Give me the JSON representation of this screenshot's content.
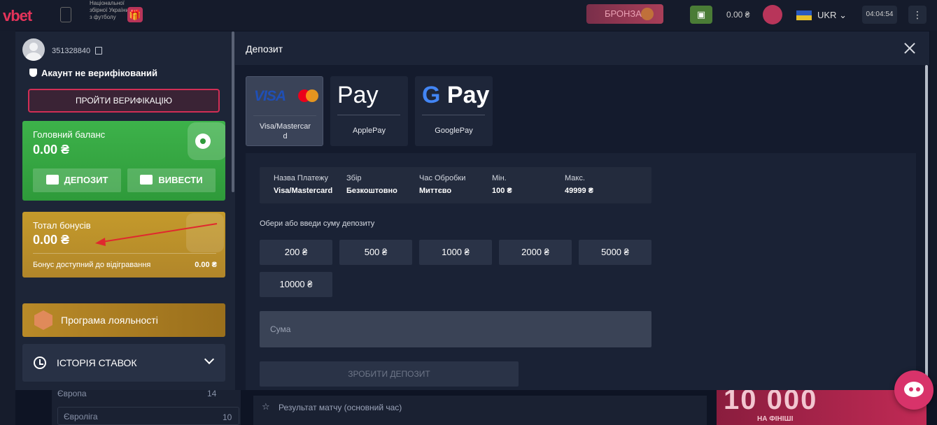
{
  "header": {
    "logo": "vbet",
    "national_text": "Національної збірної України з футболу",
    "level_badge": "БРОНЗА",
    "balance": "0.00 ₴",
    "language": "UKR",
    "time": "04:04:54"
  },
  "account": {
    "user_id": "351328840",
    "verification_status": "Акаунт не верифікований",
    "verify_button": "ПРОЙТИ ВЕРИФІКАЦІЮ",
    "main_balance": {
      "label": "Головний баланс",
      "value": "0.00 ₴",
      "deposit_button": "ДЕПОЗИТ",
      "withdraw_button": "ВИВЕСТИ"
    },
    "bonus": {
      "label": "Тотал бонусів",
      "value": "0.00 ₴",
      "sub_label": "Бонус доступний до відігравання",
      "sub_value": "0.00 ₴"
    },
    "loyalty_label": "Програма лояльності",
    "history_label": "ІСТОРІЯ СТАВОК"
  },
  "deposit": {
    "title": "Депозит",
    "methods": [
      {
        "name": "Visa/Mastercar d",
        "line1": "Visa/Mastercar",
        "line2": "d",
        "icon": "visa-mastercard-icon",
        "active": true
      },
      {
        "name": "ApplePay",
        "icon": "apple-pay-icon",
        "active": false
      },
      {
        "name": "GooglePay",
        "icon": "google-pay-icon",
        "active": false
      }
    ],
    "apple_pay_text": "Pay",
    "google_pay_text": "Pay",
    "visa_text": "VISA",
    "info": {
      "headers": [
        "Назва Платежу",
        "Збір",
        "Час Обробки",
        "Мін.",
        "Макс."
      ],
      "values": [
        "Visa/Mastercard",
        "Безкоштовно",
        "Миттєво",
        "100 ₴",
        "49999 ₴"
      ]
    },
    "choose_label": "Обери або введи суму депозиту",
    "amounts": [
      "200 ₴",
      "500 ₴",
      "1000 ₴",
      "2000 ₴",
      "5000 ₴",
      "10000 ₴"
    ],
    "sum_placeholder": "Сума",
    "submit_button": "ЗРОБИТИ ДЕПОЗИТ"
  },
  "background": {
    "list_row1": "Європа",
    "list_row1_count": "14",
    "list_row2": "Євроліга",
    "list_row2_count": "10",
    "match_label": "Результат матчу (основний час)",
    "promo_big": "10 000",
    "promo_small": "НА ФІНІШІ"
  },
  "colors": {
    "accent_red": "#d12e55",
    "balance_green": "#3db24a",
    "bonus_gold": "#c49a2b",
    "modal_bg": "#141b2d",
    "annotation_arrow": "#e0282e"
  }
}
